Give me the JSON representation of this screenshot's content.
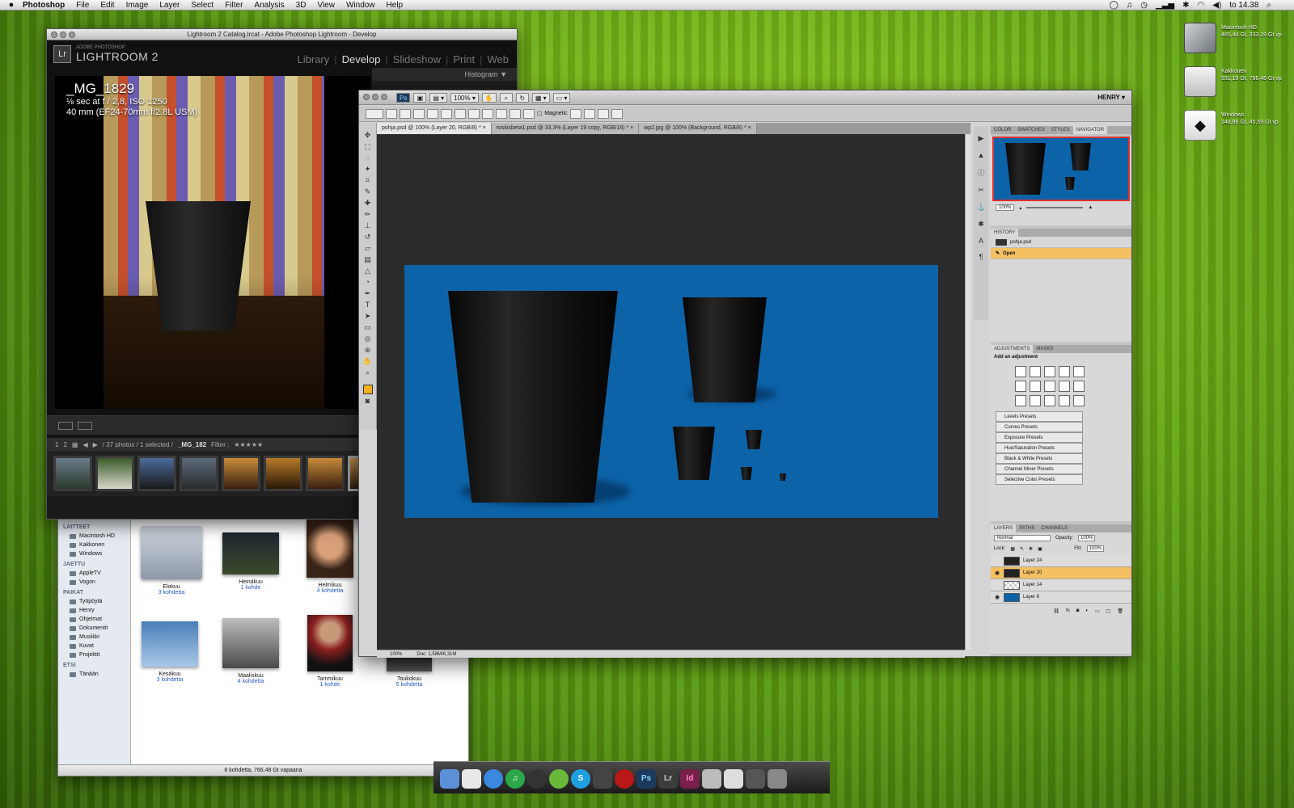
{
  "menubar": {
    "apple": "",
    "app": "Photoshop",
    "items": [
      "File",
      "Edit",
      "Image",
      "Layer",
      "Select",
      "Filter",
      "Analysis",
      "3D",
      "View",
      "Window",
      "Help"
    ],
    "clock": "to 14.38"
  },
  "desktop": {
    "icons": [
      {
        "name": "Macintosh HD",
        "info": "465,44 Gt, 333,19 Gt vp"
      },
      {
        "name": "Kakkonen",
        "info": "931,19 Gt, 766,48 Gt vp"
      },
      {
        "name": "Windows",
        "info": "148,86 Gt, 45,59 Gt vp"
      }
    ]
  },
  "lightroom": {
    "title": "Lightroom 2 Catalog.lrcat - Adobe Photoshop Lightroom - Develop",
    "brand_small": "ADOBE PHOTOSHOP",
    "brand": "LIGHTROOM 2",
    "logo": "Lr",
    "modules": [
      "Library",
      "Develop",
      "Slideshow",
      "Print",
      "Web"
    ],
    "active_module": "Develop",
    "panel_header": "Histogram",
    "photo_name": "_MG_1829",
    "exposure": "⅛ sec at f / 2,8, ISO 1250",
    "lens": "40 mm (EF24-70mm f/2.8L USM)",
    "filmstrip_pages": [
      "1",
      "2"
    ],
    "filmstrip_info": "/ 37 photos / 1 selected /",
    "filmstrip_file": "_MG_182",
    "filter_label": "Filter :"
  },
  "finder": {
    "sections": [
      {
        "title": "LAITTEET",
        "items": [
          "Macintosh HD",
          "Kakkonen",
          "Windows"
        ]
      },
      {
        "title": "JAETTU",
        "items": [
          "AppleTV",
          "Vogon"
        ]
      },
      {
        "title": "PAIKAT",
        "items": [
          "Työpöytä",
          "Henry",
          "Ohjelmat",
          "Dokumentit",
          "Musiikki",
          "Kuvat",
          "Projektit"
        ]
      },
      {
        "title": "ETSI",
        "items": [
          "Tänään"
        ]
      }
    ],
    "items": [
      {
        "name": "Elokuu",
        "count": "3 kohdetta"
      },
      {
        "name": "Heinäkuu",
        "count": "1 kohde"
      },
      {
        "name": "Helmikuu",
        "count": "4 kohdetta"
      },
      {
        "name": "Kesäkuu",
        "count": "3 kohdetta"
      },
      {
        "name": "Maaliskuu",
        "count": "4 kohdetta"
      },
      {
        "name": "Tammikuu",
        "count": "1 kohde"
      },
      {
        "name": "Toukokuu",
        "count": "5 kohdetta"
      }
    ],
    "status": "8 kohdetta, 766,48 Gt vapaana"
  },
  "photoshop": {
    "logo": "Ps",
    "zoom": "100%",
    "workspace": "HENRY ▾",
    "magnetic_label": "Magnetic",
    "tabs": [
      "pohja.psd @ 100% (Layer 20, RGB/8) *",
      "roskisbeta1.psd @ 33,3% (Layer 19 copy, RGB/16) *",
      "wp2.jpg @ 100% (Background, RGB/8) *"
    ],
    "status_zoom": "100%",
    "status_doc": "Doc: 1,58M/6,31M",
    "navigator_tabs": [
      "COLOR",
      "SWATCHES",
      "STYLES",
      "NAVIGATOR"
    ],
    "navigator_zoom": "100%",
    "history_title": "HISTORY",
    "history_items": [
      "pohja.psd",
      "Open"
    ],
    "adjust_tabs": [
      "ADJUSTMENTS",
      "MASKS"
    ],
    "adjust_hint": "Add an adjustment",
    "presets": [
      "Levels Presets",
      "Curves Presets",
      "Exposure Presets",
      "Hue/Saturation Presets",
      "Black & White Presets",
      "Channel Mixer Presets",
      "Selective Color Presets"
    ],
    "layers_tabs": [
      "LAYERS",
      "PATHS",
      "CHANNELS"
    ],
    "blend_mode": "Normal",
    "opacity_label": "Opacity:",
    "opacity": "100%",
    "lock_label": "Lock:",
    "fill_label": "Fill:",
    "fill": "100%",
    "layers": [
      {
        "name": "Layer 24",
        "visible": false,
        "selected": false
      },
      {
        "name": "Layer 20",
        "visible": true,
        "selected": true
      },
      {
        "name": "Layer 14",
        "visible": false,
        "selected": false
      },
      {
        "name": "Layer 8",
        "visible": true,
        "selected": false
      }
    ],
    "canvas_color": "#0c63a8"
  },
  "dock": {
    "apps": [
      "Finder",
      "Mail",
      "Safari",
      "iTunes",
      "DVD",
      "Adium",
      "Skype",
      "Script",
      "Rec",
      "Ps",
      "Lr",
      "Id",
      "System",
      "Docs",
      "Monitor",
      "Trash"
    ]
  }
}
